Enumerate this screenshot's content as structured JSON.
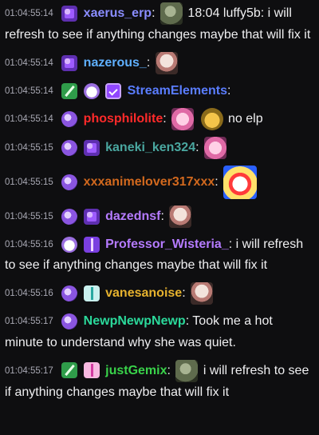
{
  "messages": [
    {
      "ts": "01:04:55:14",
      "badges": [
        "sub"
      ],
      "user": "xaerus_erp",
      "color": "#8a8dff",
      "emotes_before": [
        "frog-emote"
      ],
      "text": "18:04 luffy5b: i will refresh to see if anything changes maybe that will fix it"
    },
    {
      "ts": "01:04:55:14",
      "badges": [
        "sub"
      ],
      "user": "nazerous_",
      "color": "#5fb0ff",
      "emotes_after": [
        "face-emote"
      ],
      "text": ""
    },
    {
      "ts": "01:04:55:14",
      "badges": [
        "sword",
        "bear",
        "verified"
      ],
      "user": "StreamElements",
      "color": "#5a7dff",
      "text": ""
    },
    {
      "ts": "01:04:55:14",
      "badges": [
        "moon"
      ],
      "user": "phosphilolite",
      "color": "#ff2a2a",
      "emotes_after": [
        "pig-emote",
        "hand-emote"
      ],
      "text": "no elp"
    },
    {
      "ts": "01:04:55:15",
      "badges": [
        "moon",
        "sub"
      ],
      "user": "kaneki_ken324",
      "color": "#4aa7a0",
      "emotes_after": [
        "pig-emote"
      ],
      "text": ""
    },
    {
      "ts": "01:04:55:15",
      "badges": [
        "moon"
      ],
      "user": "xxxanimelover317xxx",
      "color": "#d2691e",
      "emotes_after": [
        "clown-emote"
      ],
      "text": ""
    },
    {
      "ts": "01:04:55:15",
      "badges": [
        "moon",
        "sub"
      ],
      "user": "dazednsf",
      "color": "#b57bff",
      "emotes_after": [
        "face-emote"
      ],
      "text": ""
    },
    {
      "ts": "01:04:55:16",
      "badges": [
        "bear",
        "gift-purple"
      ],
      "user": "Professor_Wisteria_",
      "color": "#b57bff",
      "text": "i will refresh to see if anything changes maybe that will fix it"
    },
    {
      "ts": "01:04:55:16",
      "badges": [
        "moon",
        "gift-teal"
      ],
      "user": "vanesanoise",
      "color": "#e6b22e",
      "emotes_after": [
        "face-emote"
      ],
      "text": ""
    },
    {
      "ts": "01:04:55:17",
      "badges": [
        "moon"
      ],
      "user": "NewpNewpNewp",
      "color": "#2bd99b",
      "text": "Took me a hot minute to understand why she was quiet."
    },
    {
      "ts": "01:04:55:17",
      "badges": [
        "sword",
        "gift-pink"
      ],
      "user": "justGemix",
      "color": "#39d24a",
      "emotes_after": [
        "frog-emote"
      ],
      "text": "i will refresh to see if anything changes maybe that will fix it"
    }
  ]
}
